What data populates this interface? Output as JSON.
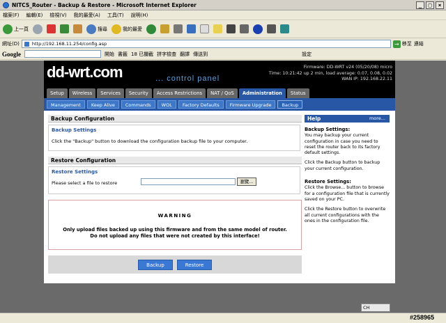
{
  "window": {
    "title": "NITCS_Router - Backup & Restore - Microsoft Internet Explorer"
  },
  "menu": [
    "檔案(F)",
    "編輯(E)",
    "檢視(V)",
    "我的最愛(A)",
    "工具(T)",
    "說明(H)"
  ],
  "toolbar": {
    "back": "上一頁",
    "search": "搜尋",
    "favorites": "我的最愛"
  },
  "address": {
    "label": "網址(D)",
    "url": "http://192.168.11.254/config.asp",
    "go": "移至",
    "links": "連結"
  },
  "googlebar": {
    "logo": "Google",
    "open": "開始",
    "bookmarks": "書籤",
    "blocked": "18 已攔截",
    "spellcheck": "拼字檢查",
    "translate": "翻譯",
    "sendto": "傳送到",
    "settings": "設定"
  },
  "router": {
    "logo": "dd-wrt.com",
    "cpanel": "... control panel",
    "firmware": "Firmware: DD-WRT v24 (05/20/08) micro",
    "time": "Time: 10:21:42 up 2 min, load average: 0.07, 0.08, 0.02",
    "wan": "WAN IP: 192.168.22.11",
    "main_tabs": [
      "Setup",
      "Wireless",
      "Services",
      "Security",
      "Access Restrictions",
      "NAT / QoS",
      "Administration",
      "Status"
    ],
    "sub_tabs": [
      "Management",
      "Keep Alive",
      "Commands",
      "WOL",
      "Factory Defaults",
      "Firmware Upgrade",
      "Backup"
    ],
    "backup_config_title": "Backup Configuration",
    "backup_settings_legend": "Backup Settings",
    "backup_settings_text": "Click the \"Backup\" button to download the configuration backup file to your computer.",
    "restore_config_title": "Restore Configuration",
    "restore_settings_legend": "Restore Settings",
    "restore_select_text": "Please select a file to restore",
    "browse_label": "瀏覽...",
    "warning_title": "WARNING",
    "warning_line1": "Only upload files backed up using this firmware and from the same model of router.",
    "warning_line2": "Do not upload any files that were not created by this interface!",
    "backup_button": "Backup",
    "restore_button": "Restore",
    "help_title": "Help",
    "help_more": "more...",
    "help_backup_heading": "Backup Settings:",
    "help_backup_text": "You may backup your current configuration in case you need to reset the router back to its factory default settings.",
    "help_backup_text2": "Click the Backup button to backup your current configuration.",
    "help_restore_heading": "Restore Settings:",
    "help_restore_text": "Click the Browse... button to browse for a configuration file that is currently saved on your PC.",
    "help_restore_text2": "Click the Restore button to overwrite all current configurations with the ones in the configuration file."
  },
  "statusbar": {
    "ime": "CH",
    "watermark": "#258965"
  }
}
